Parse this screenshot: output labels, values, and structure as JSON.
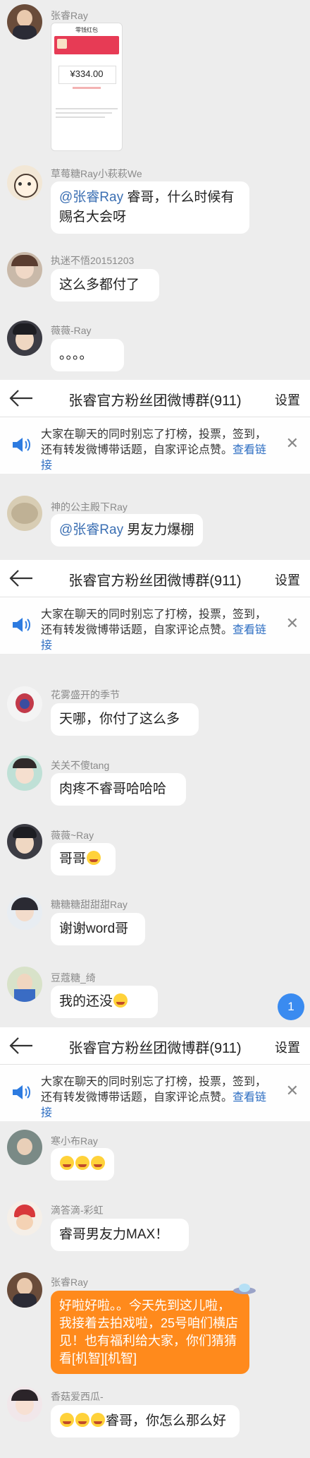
{
  "chat": {
    "group_title": "张睿官方粉丝团微博群(911)",
    "settings_label": "设置",
    "notice_text": "大家在聊天的同时别忘了打榜，投票，签到，还有转发微博带话题，自家评论点赞。",
    "notice_link": "查看链接",
    "unread_count": "1"
  },
  "messages": {
    "m0": {
      "nick": "张睿Ray"
    },
    "m1": {
      "nick": "草莓糖Ray小萩萩We",
      "mention": "@张睿Ray",
      "text": " 睿哥，什么时候有赐名大会呀"
    },
    "m2": {
      "nick": "执迷不悟20151203",
      "text": "这么多都付了"
    },
    "m3": {
      "nick": "薇薇-Ray",
      "text": "。。。。"
    },
    "m4": {
      "nick": "神的公主殿下Ray",
      "mention": "@张睿Ray",
      "text": " 男友力爆棚"
    },
    "m5": {
      "nick": "花雾盛开的季节",
      "text": "天哪，你付了这么多"
    },
    "m6": {
      "nick": "关关不傻tang",
      "text": "肉疼不睿哥哈哈哈"
    },
    "m7": {
      "nick": "薇薇~Ray",
      "text": "哥哥"
    },
    "m8": {
      "nick": "糖糖糖甜甜甜Ray",
      "text": "谢谢word哥"
    },
    "m9": {
      "nick": "豆蔻糖_绮",
      "text": "我的还没"
    },
    "m10": {
      "nick": "寒小布Ray"
    },
    "m11": {
      "nick": "滴答滴-彩虹",
      "text": "睿哥男友力MAX！"
    },
    "m12": {
      "nick": "张睿Ray",
      "text": "好啦好啦。。今天先到这儿啦，我接着去拍戏啦，25号咱们横店见！也有福利给大家，你们猜猜看[机智][机智]"
    },
    "m13": {
      "nick": "香菇爱西瓜-",
      "text": "睿哥，你怎么那么好"
    }
  },
  "payment_card": {
    "header": "零钱红包",
    "amount": "¥334.00"
  },
  "colors": {
    "accent_blue": "#2d6ec2",
    "owner_bubble": "#ff8a1c",
    "badge": "#3a8bf0"
  }
}
